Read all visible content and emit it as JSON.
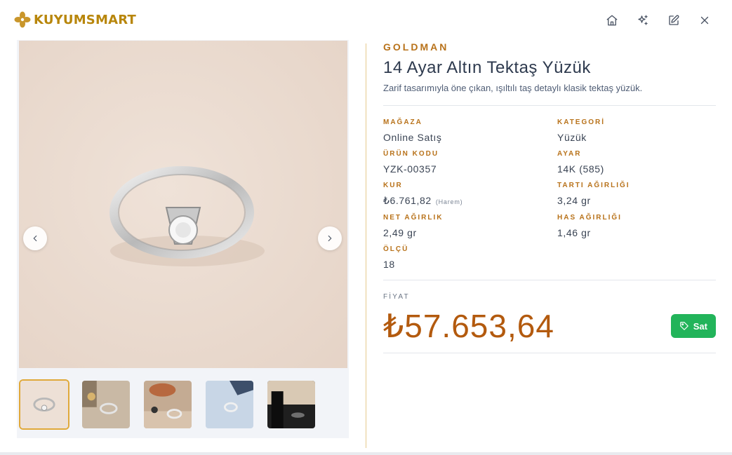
{
  "app": {
    "logo_text": "KUYUMSMART",
    "brand_color": "#b8860b"
  },
  "toolbar": {
    "actions": [
      {
        "icon": "home-icon"
      },
      {
        "icon": "sparkles-icon"
      },
      {
        "icon": "edit-icon"
      },
      {
        "icon": "close-icon"
      }
    ]
  },
  "gallery": {
    "prev_icon": "chevron-left-icon",
    "next_icon": "chevron-right-icon",
    "thumbnail_count": 5,
    "active_index": 0
  },
  "product": {
    "brand": "GOLDMAN",
    "title": "14 Ayar Altın Tektaş Yüzük",
    "description": "Zarif tasarımıyla öne çıkan, ışıltılı taş detaylı klasik tektaş yüzük.",
    "fields": {
      "store_label": "MAĞAZA",
      "store_value": "Online Satış",
      "category_label": "KATEGORİ",
      "category_value": "Yüzük",
      "code_label": "ÜRÜN KODU",
      "code_value": "YZK-00357",
      "karat_label": "AYAR",
      "karat_value": "14K (585)",
      "rate_label": "KUR",
      "rate_value": "₺6.761,82",
      "rate_note": "(Harem)",
      "gross_label": "TARTI AĞIRLIĞI",
      "gross_value": "3,24 gr",
      "net_label": "NET AĞIRLIK",
      "net_value": "2,49 gr",
      "pure_label": "HAS AĞIRLIĞI",
      "pure_value": "1,46 gr",
      "size_label": "ÖLÇÜ",
      "size_value": "18"
    },
    "price_label": "FİYAT",
    "price_value": "₺57.653,64",
    "sell_button": "Sat",
    "accent_color": "#b8721a",
    "price_color": "#b35a0e",
    "sell_color": "#22b45a"
  }
}
